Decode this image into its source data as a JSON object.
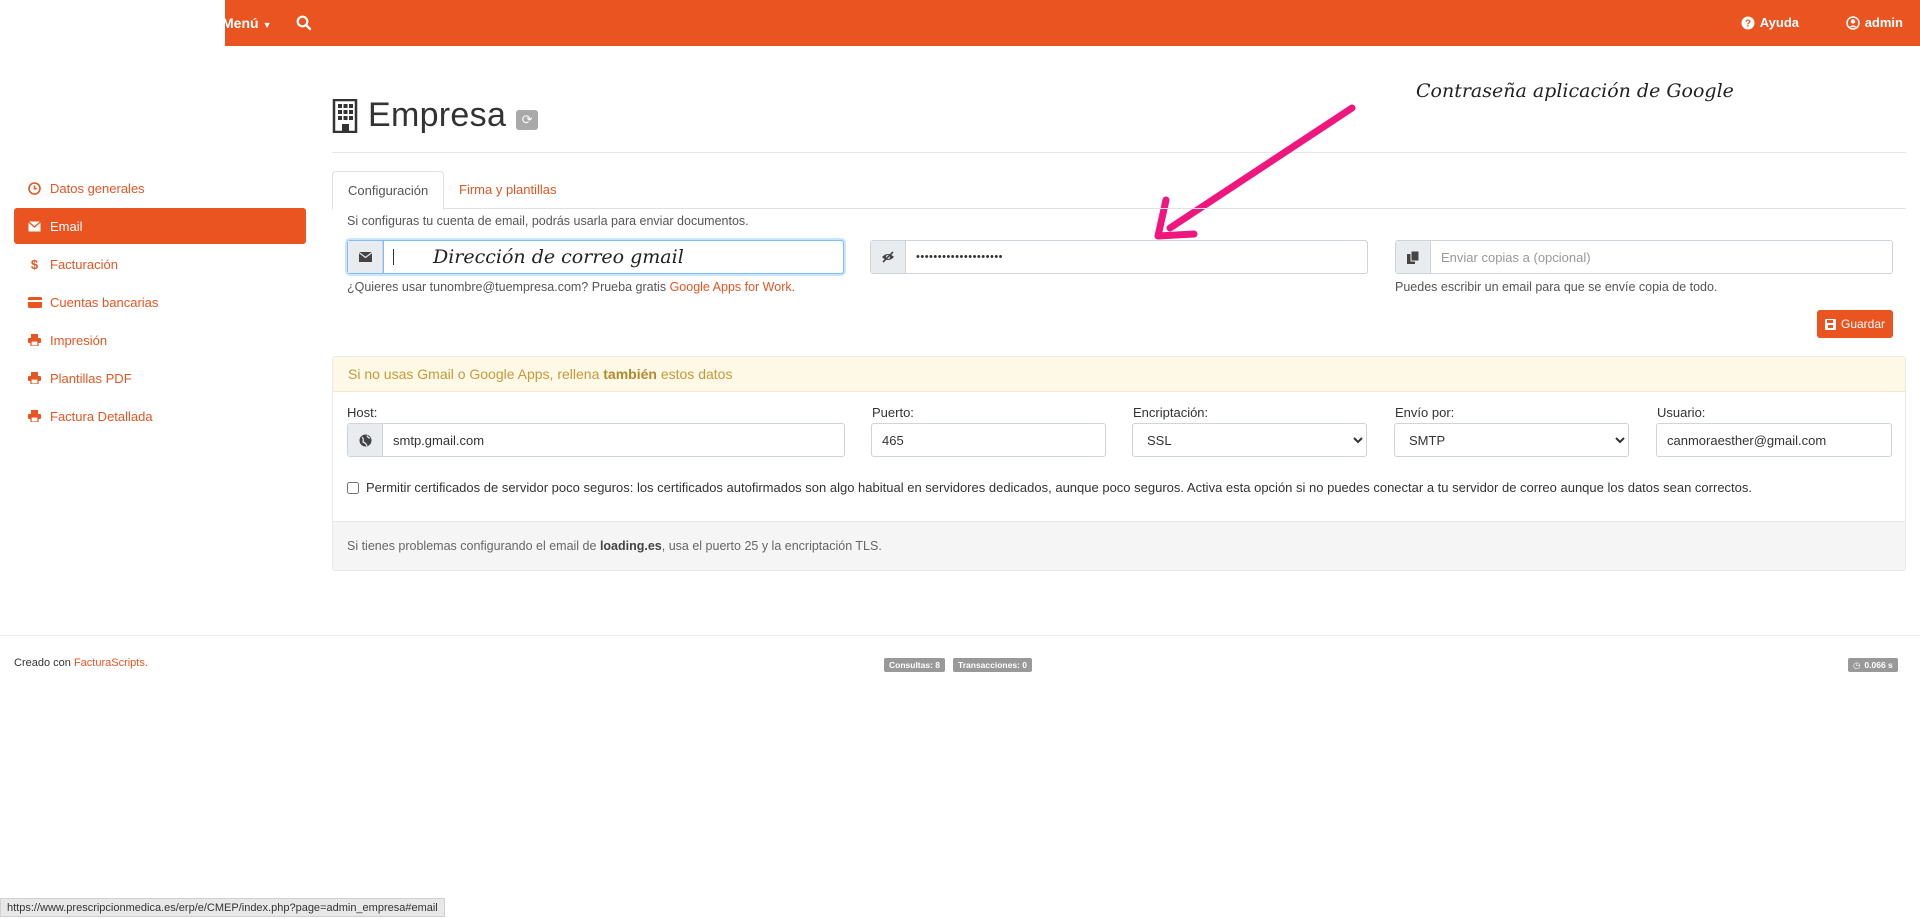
{
  "topbar": {
    "menu_label": "Menú",
    "help_label": "Ayuda",
    "user_label": "admin"
  },
  "sidebar": {
    "items": [
      {
        "label": "Datos generales",
        "icon": "clock-icon"
      },
      {
        "label": "Email",
        "icon": "envelope-icon",
        "active": true
      },
      {
        "label": "Facturación",
        "icon": "dollar-icon"
      },
      {
        "label": "Cuentas bancarias",
        "icon": "credit-card-icon"
      },
      {
        "label": "Impresión",
        "icon": "printer-icon"
      },
      {
        "label": "Plantillas PDF",
        "icon": "printer-icon"
      },
      {
        "label": "Factura Detallada",
        "icon": "printer-icon"
      }
    ]
  },
  "page": {
    "title": "Empresa",
    "annotation_google": "Contraseña aplicación de Google",
    "annotation_email": "Dirección de correo gmail"
  },
  "tabs": [
    {
      "label": "Configuración",
      "active": true
    },
    {
      "label": "Firma y plantillas",
      "active": false
    }
  ],
  "email_section": {
    "intro": "Si configuras tu cuenta de email, podrás usarla para enviar documentos.",
    "email_value": "",
    "password_value": "••••••••••••••••••••",
    "copy_placeholder": "Enviar copias a (opcional)",
    "help_email_prefix": "¿Quieres usar tunombre@tuempresa.com? Prueba gratis ",
    "help_email_link": "Google Apps for Work.",
    "help_copy": "Puedes escribir un email para que se envíe copia de todo.",
    "save_label": "Guardar"
  },
  "smtp": {
    "header_prefix": "Si no usas Gmail o Google Apps, rellena ",
    "header_bold": "también",
    "header_suffix": " estos datos",
    "host_label": "Host:",
    "host_value": "smtp.gmail.com",
    "port_label": "Puerto:",
    "port_value": "465",
    "enc_label": "Encriptación:",
    "enc_value": "SSL",
    "via_label": "Envío por:",
    "via_value": "SMTP",
    "user_label": "Usuario:",
    "user_value": "canmoraesther@gmail.com",
    "checkbox_label": "Permitir certificados de servidor poco seguros: los certificados autofirmados son algo habitual en servidores dedicados, aunque poco seguros. Activa esta opción si no puedes conectar a tu servidor de correo aunque los datos sean correctos.",
    "foot_prefix": "Si tienes problemas configurando el email de ",
    "foot_bold": "loading.es",
    "foot_suffix": ", usa el puerto 25 y la encriptación TLS."
  },
  "footer": {
    "created_prefix": "Creado con ",
    "created_link": "FacturaScripts.",
    "badge_queries": "Consultas: 8",
    "badge_transactions": "Transacciones: 0",
    "badge_time": "0.066 s"
  },
  "status_url": "https://www.prescripcionmedica.es/erp/e/CMEP/index.php?page=admin_empresa#email",
  "colors": {
    "accent": "#ea5421",
    "annotation_arrow": "#f0167e"
  }
}
